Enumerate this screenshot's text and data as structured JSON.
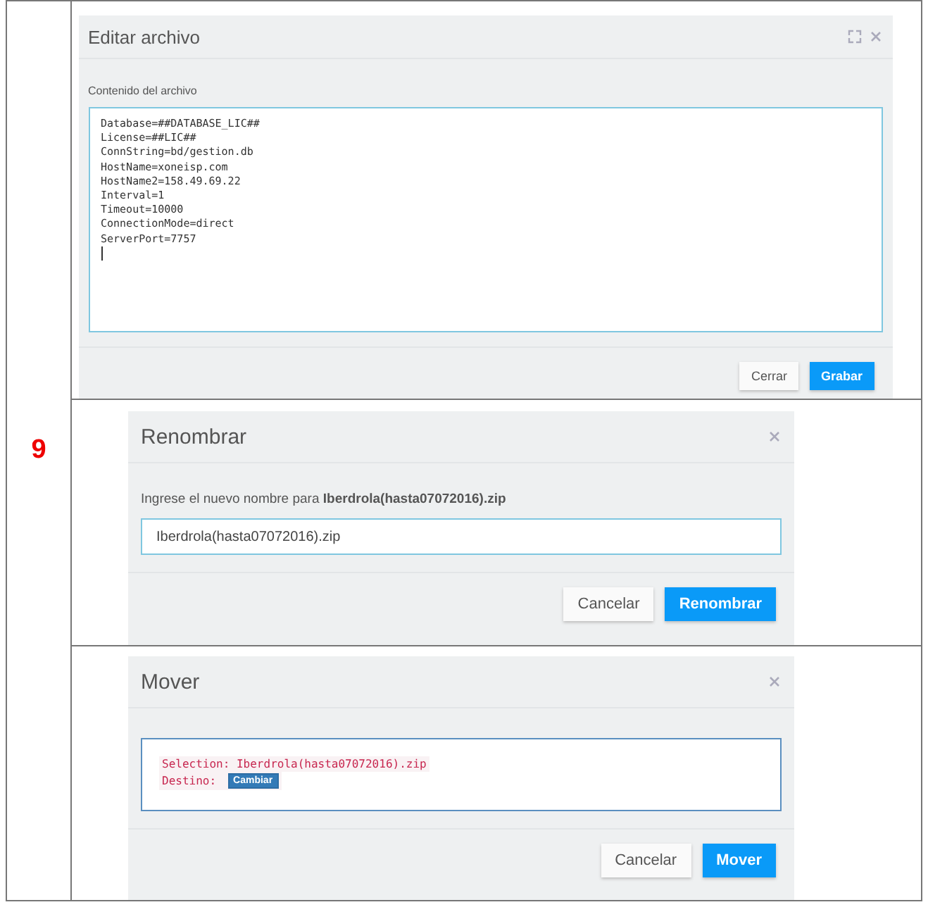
{
  "row_label": "9",
  "edit_dialog": {
    "title": "Editar archivo",
    "field_label": "Contenido del archivo",
    "content": [
      "Database=##DATABASE_LIC##",
      "License=##LIC##",
      "ConnString=bd/gestion.db",
      "HostName=xoneisp.com",
      "HostName2=158.49.69.22",
      "Interval=1",
      "Timeout=10000",
      "ConnectionMode=direct",
      "ServerPort=7757"
    ],
    "buttons": [
      {
        "label": "Cerrar",
        "kind": "default"
      },
      {
        "label": "Grabar",
        "kind": "primary"
      }
    ]
  },
  "rename_dialog": {
    "title": "Renombrar",
    "prompt": "Ingrese el nuevo nombre para **Iberdrola(hasta07072016).zip**",
    "value": "Iberdrola(hasta07072016).zip",
    "buttons": [
      {
        "label": "Cancelar",
        "kind": "default"
      },
      {
        "label": "Renombrar",
        "kind": "primary"
      }
    ]
  },
  "move_dialog": {
    "title": "Mover",
    "selection": "Selection: Iberdrola(hasta07072016).zip",
    "destination_label": "Destino:",
    "change_button": "Cambiar",
    "buttons": [
      {
        "label": "Cancelar",
        "kind": "default"
      },
      {
        "label": "Mover",
        "kind": "primary"
      }
    ]
  }
}
